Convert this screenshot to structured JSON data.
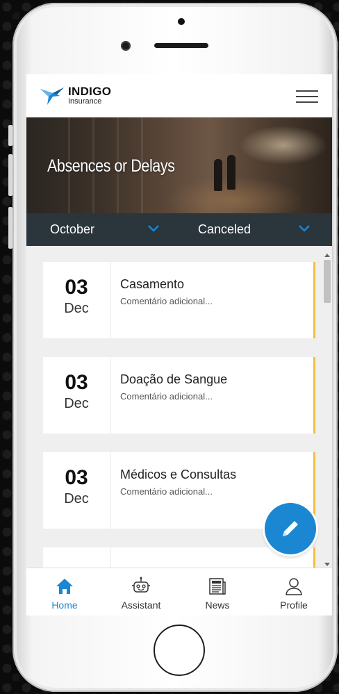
{
  "app": {
    "brand": "INDIGO",
    "brand_sub": "Insurance",
    "accent_color": "#1b87d3",
    "card_accent_color": "#f0c040"
  },
  "hero": {
    "title": "Absences or Delays"
  },
  "filters": {
    "month": "October",
    "status": "Canceled"
  },
  "entries": [
    {
      "day": "03",
      "month": "Dec",
      "title": "Casamento",
      "comment": "Comentário adicional..."
    },
    {
      "day": "03",
      "month": "Dec",
      "title": "Doação de Sangue",
      "comment": "Comentário adicional..."
    },
    {
      "day": "03",
      "month": "Dec",
      "title": "Médicos e Consultas",
      "comment": "Comentário adicional..."
    }
  ],
  "nav": {
    "items": [
      {
        "label": "Home",
        "icon": "home-icon",
        "active": true
      },
      {
        "label": "Assistant",
        "icon": "robot-icon",
        "active": false
      },
      {
        "label": "News",
        "icon": "newspaper-icon",
        "active": false
      },
      {
        "label": "Profile",
        "icon": "user-icon",
        "active": false
      }
    ]
  },
  "fab": {
    "icon": "pencil-icon"
  }
}
